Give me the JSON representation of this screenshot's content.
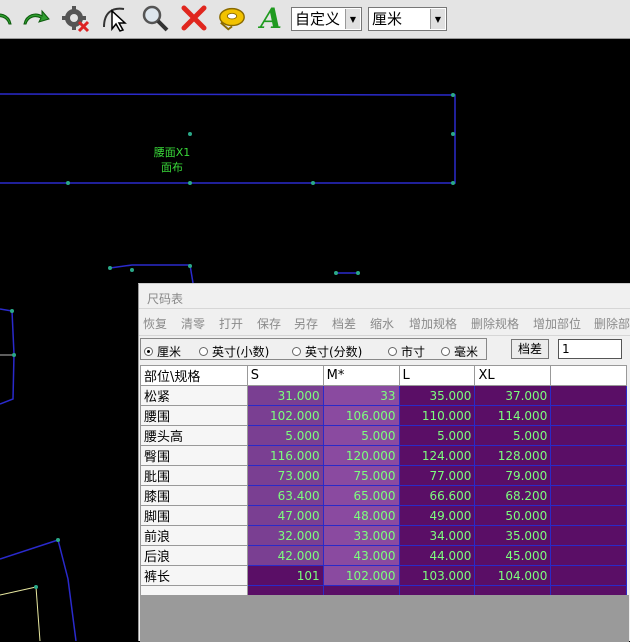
{
  "toolbar": {
    "icons": [
      "undo-icon",
      "redo-icon",
      "gear-icon",
      "pointer-icon",
      "magnifier-icon",
      "delete-x-icon",
      "tape-measure-icon",
      "text-a-icon"
    ],
    "text_tool_label": "A",
    "preset_select": "自定义",
    "unit_select": "厘米"
  },
  "canvas": {
    "pattern_label_1": "腰面X1",
    "pattern_label_2": "面布",
    "pattern_color": "#2a2acc",
    "label_color": "#39d839"
  },
  "dialog": {
    "title": "尺码表",
    "menu": [
      "恢复",
      "清零",
      "打开",
      "保存",
      "另存",
      "档差",
      "缩水",
      "增加规格",
      "删除规格",
      "增加部位",
      "删除部"
    ],
    "units": [
      "厘米",
      "英寸(小数)",
      "英寸(分数)",
      "市寸",
      "毫米"
    ],
    "selected_unit": "厘米",
    "grade_button": "档差",
    "grade_value": "1",
    "table": {
      "headers": [
        "部位\\规格",
        "S",
        "M*",
        "L",
        "XL",
        ""
      ],
      "rows": [
        {
          "name": "松紧",
          "values": [
            "31.000",
            "33",
            "35.000",
            "37.000"
          ]
        },
        {
          "name": "腰围",
          "values": [
            "102.000",
            "106.000",
            "110.000",
            "114.000"
          ]
        },
        {
          "name": "腰头高",
          "values": [
            "5.000",
            "5.000",
            "5.000",
            "5.000"
          ]
        },
        {
          "name": "臀围",
          "values": [
            "116.000",
            "120.000",
            "124.000",
            "128.000"
          ]
        },
        {
          "name": "肶围",
          "values": [
            "73.000",
            "75.000",
            "77.000",
            "79.000"
          ]
        },
        {
          "name": "膝围",
          "values": [
            "63.400",
            "65.000",
            "66.600",
            "68.200"
          ]
        },
        {
          "name": "脚围",
          "values": [
            "47.000",
            "48.000",
            "49.000",
            "50.000"
          ]
        },
        {
          "name": "前浪",
          "values": [
            "32.000",
            "33.000",
            "34.000",
            "35.000"
          ]
        },
        {
          "name": "后浪",
          "values": [
            "42.000",
            "43.000",
            "44.000",
            "45.000"
          ]
        },
        {
          "name": "裤长",
          "values": [
            "101",
            "102.000",
            "103.000",
            "104.000"
          ]
        }
      ]
    }
  }
}
